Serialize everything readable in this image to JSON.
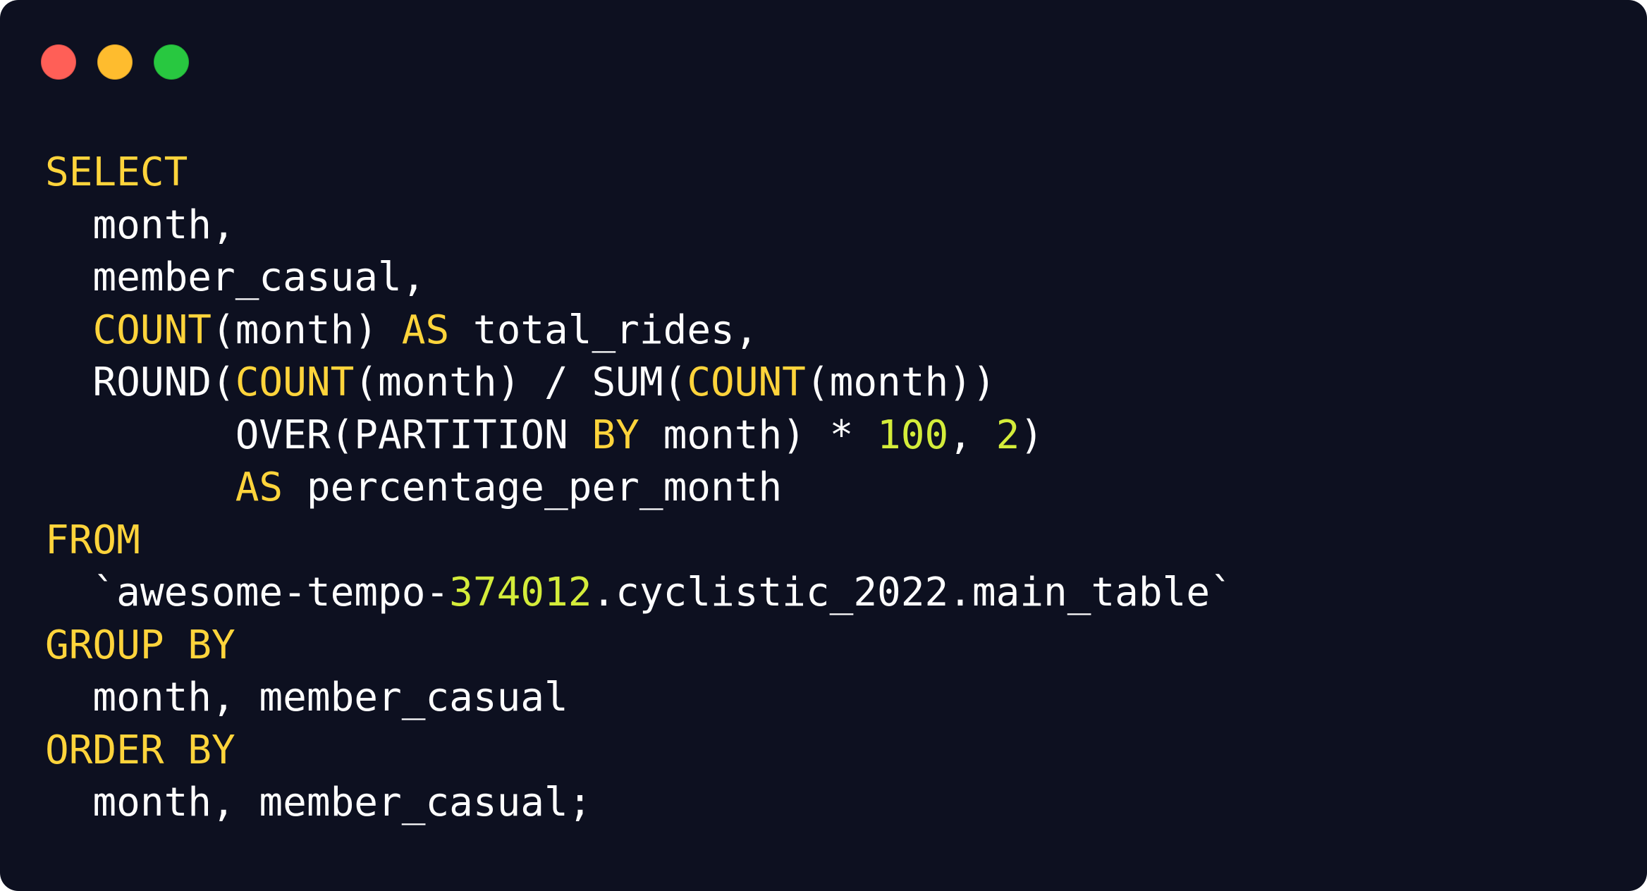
{
  "window": {
    "background": "#0d1020",
    "controls": [
      {
        "name": "close",
        "color": "#ff5f57"
      },
      {
        "name": "minimize",
        "color": "#febc2e"
      },
      {
        "name": "maximize",
        "color": "#28c840"
      }
    ]
  },
  "colors": {
    "keyword": "#ffd43b",
    "number": "#d4ec3a",
    "text": "#ffffff"
  },
  "code": {
    "language": "sql",
    "lines": [
      [
        {
          "t": "SELECT",
          "c": "kw"
        }
      ],
      [
        {
          "t": "  month,",
          "c": "plain"
        }
      ],
      [
        {
          "t": "  member_casual,",
          "c": "plain"
        }
      ],
      [
        {
          "t": "  ",
          "c": "plain"
        },
        {
          "t": "COUNT",
          "c": "kw"
        },
        {
          "t": "(month) ",
          "c": "plain"
        },
        {
          "t": "AS",
          "c": "kw"
        },
        {
          "t": " total_rides,",
          "c": "plain"
        }
      ],
      [
        {
          "t": "  ROUND(",
          "c": "plain"
        },
        {
          "t": "COUNT",
          "c": "kw"
        },
        {
          "t": "(month) / SUM(",
          "c": "plain"
        },
        {
          "t": "COUNT",
          "c": "kw"
        },
        {
          "t": "(month))",
          "c": "plain"
        }
      ],
      [
        {
          "t": "        OVER(PARTITION ",
          "c": "plain"
        },
        {
          "t": "BY",
          "c": "kw"
        },
        {
          "t": " month) * ",
          "c": "plain"
        },
        {
          "t": "100",
          "c": "num"
        },
        {
          "t": ", ",
          "c": "plain"
        },
        {
          "t": "2",
          "c": "num"
        },
        {
          "t": ")",
          "c": "plain"
        }
      ],
      [
        {
          "t": "        ",
          "c": "plain"
        },
        {
          "t": "AS",
          "c": "kw"
        },
        {
          "t": " percentage_per_month",
          "c": "plain"
        }
      ],
      [
        {
          "t": "FROM",
          "c": "kw"
        }
      ],
      [
        {
          "t": "  `awesome-tempo-",
          "c": "plain"
        },
        {
          "t": "374012",
          "c": "num"
        },
        {
          "t": ".cyclistic_2022.main_table`",
          "c": "plain"
        }
      ],
      [
        {
          "t": "GROUP BY",
          "c": "kw"
        }
      ],
      [
        {
          "t": "  month, member_casual",
          "c": "plain"
        }
      ],
      [
        {
          "t": "ORDER BY",
          "c": "kw"
        }
      ],
      [
        {
          "t": "  month, member_casual;",
          "c": "plain"
        }
      ]
    ]
  }
}
